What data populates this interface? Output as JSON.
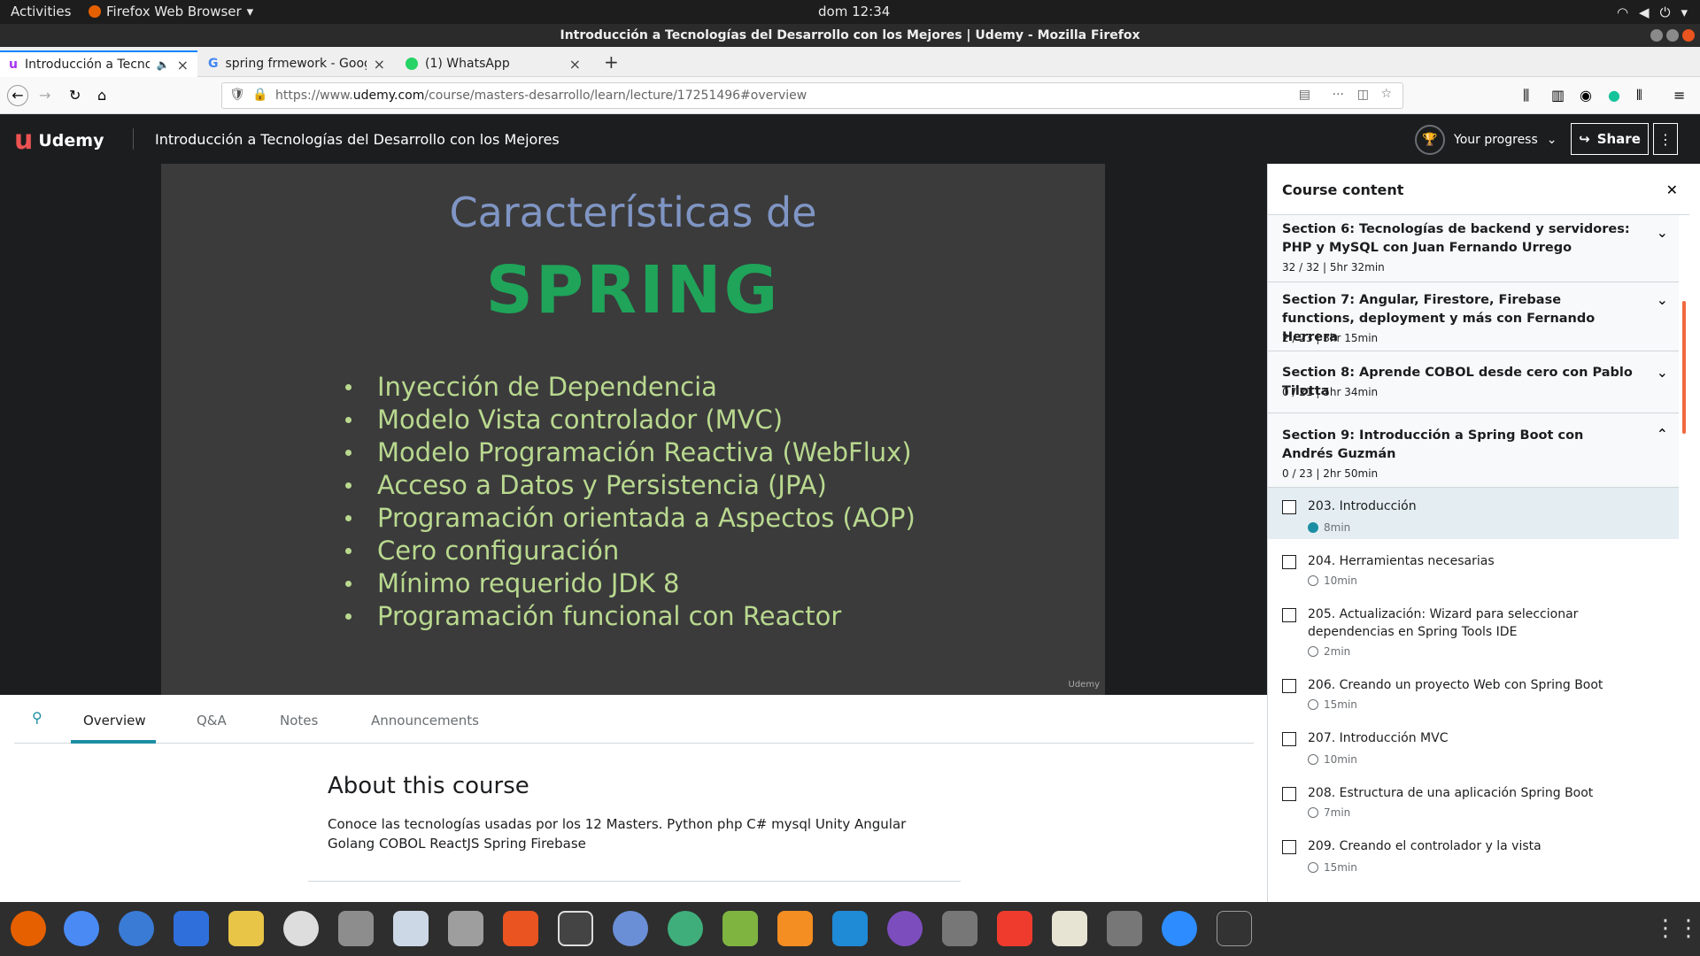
{
  "topbar": {
    "activities": "Activities",
    "app_name": "Firefox Web Browser",
    "clock": "dom 12:34"
  },
  "window": {
    "title": "Introducción a Tecnologías del Desarrollo con los Mejores | Udemy - Mozilla Firefox"
  },
  "tabs": [
    {
      "label": "Introducción a Tecnolo"
    },
    {
      "label": "spring frmework - Googl"
    },
    {
      "label": "(1) WhatsApp"
    }
  ],
  "url": {
    "prefix": "https://www.",
    "domain": "udemy.com",
    "path": "/course/masters-desarrollo/learn/lecture/17251496#overview"
  },
  "header": {
    "logo": "Udemy",
    "course_title": "Introducción a Tecnologías del Desarrollo con los Mejores",
    "progress_label": "Your progress",
    "share_label": "Share"
  },
  "slide": {
    "heading1": "Características de",
    "heading2": "SPRING",
    "bullets": [
      "Inyección de Dependencia",
      "Modelo Vista controlador  (MVC)",
      "Modelo Programación Reactiva (WebFlux)",
      "Acceso a Datos y Persistencia (JPA)",
      "Programación orientada a Aspectos (AOP)",
      "Cero configuración",
      "Mínimo requerido JDK 8",
      "Programación funcional con Reactor"
    ],
    "watermark": "Udemy"
  },
  "subnav": {
    "tabs": [
      "Overview",
      "Q&A",
      "Notes",
      "Announcements"
    ]
  },
  "about": {
    "title": "About this course",
    "description": "Conoce las tecnologías usadas por los 12 Masters. Python php C# mysql Unity Angular Golang COBOL ReactJS Spring Firebase"
  },
  "sidebar": {
    "title": "Course content",
    "sections": [
      {
        "title": "Section 6: Tecnologías de backend y servidores: PHP y MySQL con Juan Fernando Urrego",
        "meta": "32 / 32  |  5hr 32min"
      },
      {
        "title": "Section 7: Angular, Firestore, Firebase functions, deployment y más con Fernando Herrera",
        "meta": "2 / 23  |  3hr 15min"
      },
      {
        "title": "Section 8: Aprende COBOL desde cero con Pablo Tilotta",
        "meta": "0 / 21  |  5hr 34min"
      },
      {
        "title": "Section 9: Introducción a Spring Boot con Andrés Guzmán",
        "meta": "0 / 23  |  2hr 50min"
      }
    ],
    "items": [
      {
        "title": "203. Introducción",
        "duration": "8min"
      },
      {
        "title": "204. Herramientas necesarias",
        "duration": "10min"
      },
      {
        "title": "205. Actualización: Wizard para seleccionar dependencias en Spring Tools IDE",
        "duration": "2min"
      },
      {
        "title": "206. Creando un proyecto Web con Spring Boot",
        "duration": "15min"
      },
      {
        "title": "207. Introducción MVC",
        "duration": "10min"
      },
      {
        "title": "208. Estructura de una aplicación Spring Boot",
        "duration": "7min"
      },
      {
        "title": "209. Creando el controlador y la vista",
        "duration": "15min"
      }
    ]
  },
  "colors": {
    "udemy_red": "#a435f0",
    "accent": "#1c8ea3",
    "spring_green": "#1fa45a"
  }
}
